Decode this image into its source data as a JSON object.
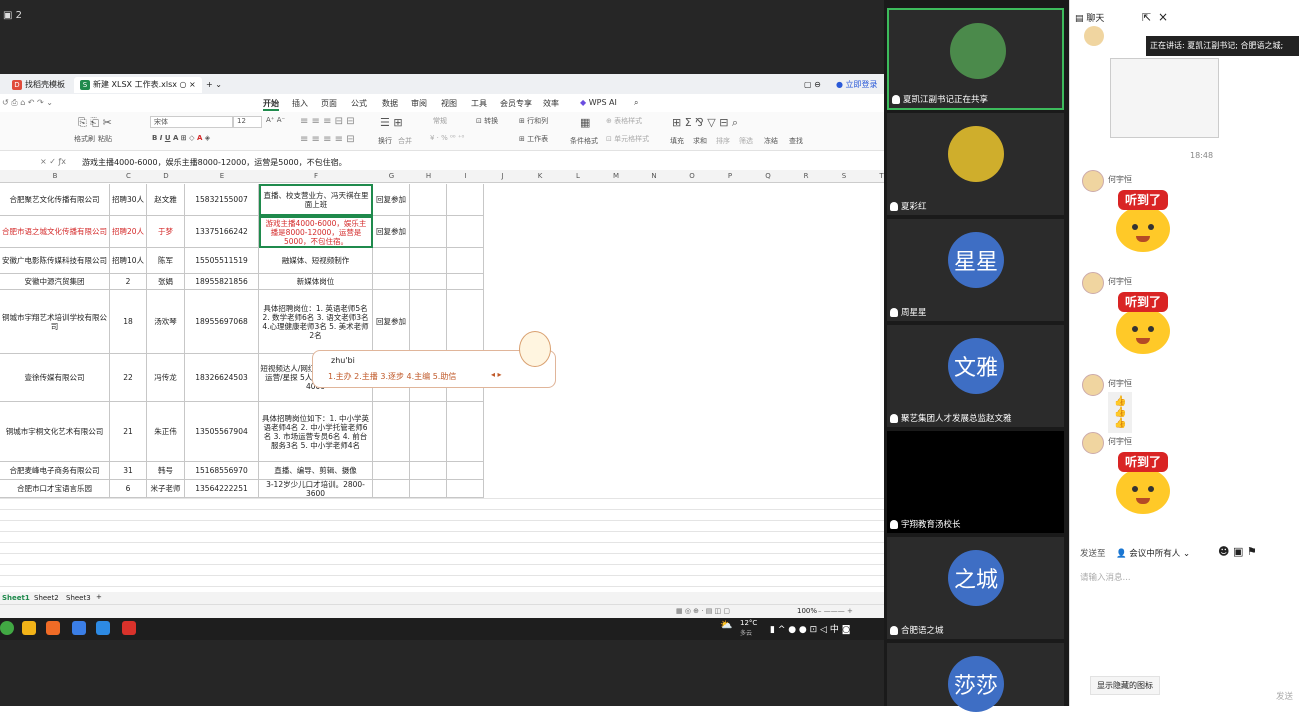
{
  "share": {
    "screen_count": "2",
    "file_tabs": [
      "找稻壳模板",
      "新建 XLSX 工作表.xlsx"
    ],
    "login_label": "立即登录",
    "ribbon_tabs": [
      "开始",
      "插入",
      "页面",
      "公式",
      "数据",
      "审阅",
      "视图",
      "工具",
      "会员专享",
      "效率",
      "WPS AI"
    ],
    "toolbar": {
      "format_painter": "格式刷",
      "paste": "粘贴",
      "font": "宋体",
      "font_size": "12",
      "wrap": "换行",
      "merge": "合并",
      "number_format": "常规",
      "convert": "转换",
      "row_col": "行和列",
      "sheet": "工作表",
      "cond_format": "条件格式",
      "cell_style": "单元格样式",
      "table_style": "表格样式",
      "fill": "填充",
      "sum": "求和",
      "sort": "排序",
      "filter": "筛选",
      "freeze": "冻结",
      "find": "查找"
    },
    "formula_text": "游戏主播4000-6000，娱乐主播8000-12000，运营是5000，不包住宿。",
    "columns": [
      "B",
      "C",
      "D",
      "E",
      "F",
      "G",
      "H",
      "I",
      "J",
      "K",
      "L",
      "M",
      "N",
      "O",
      "P",
      "Q",
      "R",
      "S",
      "T"
    ],
    "rows": [
      {
        "company": "合肥聚艺文化传播有限公司",
        "count": "招聘30人",
        "contact": "赵文雅",
        "phone": "15832155007",
        "position": "直播、校支营业方、冯天祺在里面上班",
        "status": "回复参加",
        "red": false
      },
      {
        "company": "合肥市语之城文化传播有限公司",
        "count": "招聘20人",
        "contact": "于梦",
        "phone": "13375166242",
        "position": "游戏主播4000-6000，娱乐主播是8000-12000，运营是5000，不包住宿。",
        "status": "回复参加",
        "red": true
      },
      {
        "company": "安徽广电影陈传媒科技有限公司",
        "count": "招聘10人",
        "contact": "陈军",
        "phone": "15505511519",
        "position": "融媒体、短视频制作",
        "status": "",
        "red": false
      },
      {
        "company": "安徽中源汽贸集团",
        "count": "2",
        "contact": "张娟",
        "phone": "18955821856",
        "position": "新媒体岗位",
        "status": "",
        "red": false
      },
      {
        "company": "铜城市宇翔艺术培训学校有限公司",
        "count": "18",
        "contact": "汤欢琴",
        "phone": "18955697068",
        "position": "具体招聘岗位：1. 英语老师5名 2. 数学老师6名 3. 语文老师3名 4.心理健康老师3名 5. 美术老师2名",
        "status": "回复参加",
        "red": false
      },
      {
        "company": "壹徐传媒有限公司",
        "count": "22",
        "contact": "冯传龙",
        "phone": "18326624503",
        "position": "短视频达人/网红 15 6000-8000 运营/星探 5人 4000 人事 2人 4000",
        "status": "",
        "red": false
      },
      {
        "company": "铜城市宇桐文化艺术有限公司",
        "count": "21",
        "contact": "朱正伟",
        "phone": "13505567904",
        "position": "具体招聘岗位如下：1. 中小学英语老师4名 2. 中小学托管老师6名 3. 市场运营专员6名 4. 前台服务3名 5. 中小学老师4名",
        "status": "",
        "red": false
      },
      {
        "company": "合肥麦峰电子商务有限公司",
        "count": "31",
        "contact": "韩号",
        "phone": "15168556970",
        "position": "直播、编导、剪辑、摄像",
        "status": "",
        "red": false
      },
      {
        "company": "合肥市口才宝语言乐园",
        "count": "6",
        "contact": "米子老师",
        "phone": "13564222251",
        "position": "3-12岁少儿口才培训。2800-3600",
        "status": "",
        "red": false
      }
    ],
    "ime": {
      "pinyin": "zhu'bi",
      "candidates": "1.主办 2.主播 3.逐步 4.主编 5.助信"
    },
    "sheet_tabs": [
      "Sheet1",
      "Sheet2",
      "Sheet3"
    ],
    "zoom": "100%",
    "weather": "12°C",
    "weather_desc": "多云"
  },
  "videos": [
    {
      "name": "夏凯江副书记正在共享",
      "avatar": "",
      "active": true
    },
    {
      "name": "夏彩红",
      "avatar": "",
      "active": false
    },
    {
      "name": "周星星",
      "avatar": "星星",
      "active": false
    },
    {
      "name": "聚艺集团人才发展总监赵文雅",
      "avatar": "文雅",
      "active": false
    },
    {
      "name": "宇翔教育汤校长",
      "avatar": "",
      "active": false
    },
    {
      "name": "合肥语之城",
      "avatar": "之城",
      "active": false
    },
    {
      "name": "",
      "avatar": "莎莎",
      "active": false
    }
  ],
  "chat": {
    "title": "聊天",
    "speaking_label": "正在讲话: 夏凯江副书记; 合肥语之城;",
    "timestamp": "18:48",
    "sender": "何宇恒",
    "sticker_text": "听到了",
    "thumbs": "👍👍👍",
    "send_to_label": "发送至",
    "recipient": "会议中所有人",
    "input_placeholder": "请输入消息...",
    "show_hidden": "显示隐藏的图标",
    "send_label": "发送"
  }
}
